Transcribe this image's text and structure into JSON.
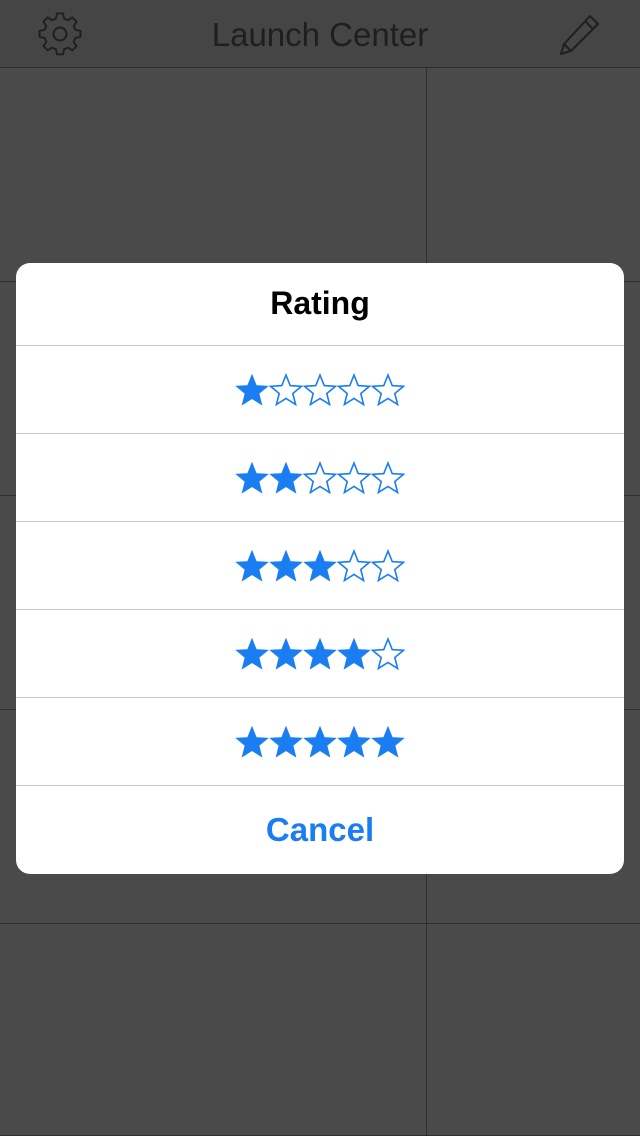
{
  "navbar": {
    "title": "Launch Center",
    "left_icon": "gear-icon",
    "right_icon": "pencil-icon"
  },
  "sheet": {
    "title": "Rating",
    "options": [
      {
        "rating": 1,
        "max": 5
      },
      {
        "rating": 2,
        "max": 5
      },
      {
        "rating": 3,
        "max": 5
      },
      {
        "rating": 4,
        "max": 5
      },
      {
        "rating": 5,
        "max": 5
      }
    ],
    "cancel_label": "Cancel"
  },
  "colors": {
    "accent": "#1a7ef2",
    "background": "#4a4a4a",
    "sheet": "#ffffff",
    "separator": "#c8c7cc"
  }
}
